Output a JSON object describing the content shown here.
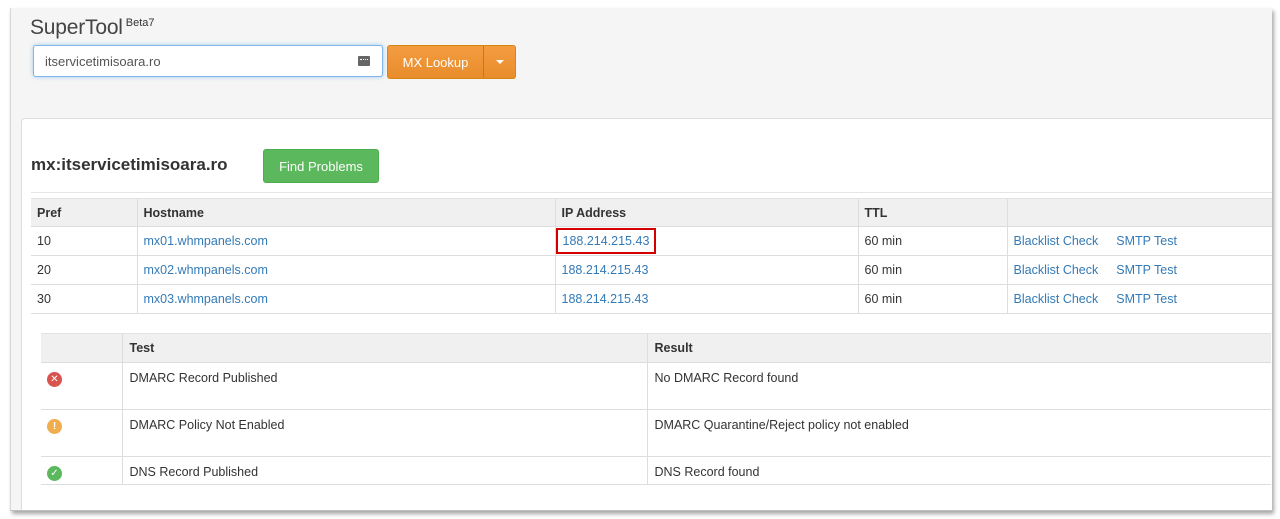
{
  "brand": {
    "name": "SuperTool",
    "version": "Beta7"
  },
  "search": {
    "value": "itservicetimisoara.ro",
    "button_label": "MX Lookup",
    "icon": "keyboard-icon"
  },
  "panel": {
    "title": "mx:itservicetimisoara.ro",
    "find_problems_label": "Find Problems"
  },
  "mx_table": {
    "headers": [
      "Pref",
      "Hostname",
      "IP Address",
      "TTL",
      ""
    ],
    "rows": [
      {
        "pref": "10",
        "hostname": "mx01.whmpanels.com",
        "ip": "188.214.215.43",
        "ttl": "60 min",
        "blacklist": "Blacklist Check",
        "smtp": "SMTP Test"
      },
      {
        "pref": "20",
        "hostname": "mx02.whmpanels.com",
        "ip": "188.214.215.43",
        "ttl": "60 min",
        "blacklist": "Blacklist Check",
        "smtp": "SMTP Test"
      },
      {
        "pref": "30",
        "hostname": "mx03.whmpanels.com",
        "ip": "188.214.215.43",
        "ttl": "60 min",
        "blacklist": "Blacklist Check",
        "smtp": "SMTP Test"
      }
    ]
  },
  "test_table": {
    "headers": [
      "",
      "Test",
      "Result"
    ],
    "rows": [
      {
        "status": "error",
        "icon": "x-circle-icon",
        "glyph": "✕",
        "test": "DMARC Record Published",
        "result": "No DMARC Record found"
      },
      {
        "status": "warning",
        "icon": "exclamation-circle-icon",
        "glyph": "!",
        "test": "DMARC Policy Not Enabled",
        "result": "DMARC Quarantine/Reject policy not enabled"
      },
      {
        "status": "ok",
        "icon": "check-circle-icon",
        "glyph": "✓",
        "test": "DNS Record Published",
        "result": "DNS Record found"
      }
    ]
  },
  "colors": {
    "orange": "#f0ad4e",
    "green": "#5cb85c",
    "red": "#d9534f",
    "link": "#337ab7",
    "highlight": "#d40000"
  }
}
